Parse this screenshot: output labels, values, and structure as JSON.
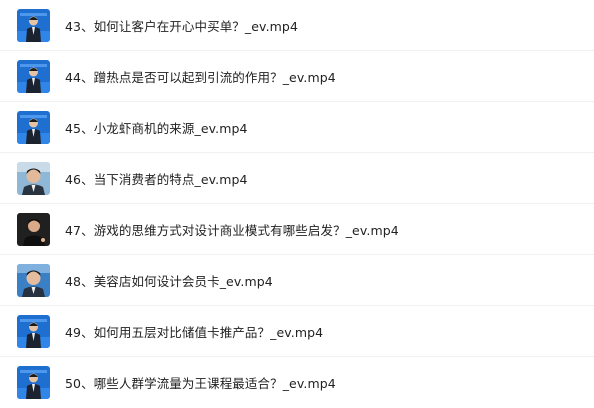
{
  "files": [
    {
      "name": "43、如何让客户在开心中买单？_ev.mp4",
      "thumbnail": "video-thumbnail-blue-stage"
    },
    {
      "name": "44、蹭热点是否可以起到引流的作用？_ev.mp4",
      "thumbnail": "video-thumbnail-blue-stage"
    },
    {
      "name": "45、小龙虾商机的来源_ev.mp4",
      "thumbnail": "video-thumbnail-blue-stage"
    },
    {
      "name": "46、当下消费者的特点_ev.mp4",
      "thumbnail": "video-thumbnail-closeup"
    },
    {
      "name": "47、游戏的思维方式对设计商业模式有哪些启发？_ev.mp4",
      "thumbnail": "video-thumbnail-dark"
    },
    {
      "name": "48、美容店如何设计会员卡_ev.mp4",
      "thumbnail": "video-thumbnail-closeup"
    },
    {
      "name": "49、如何用五层对比储值卡推产品？_ev.mp4",
      "thumbnail": "video-thumbnail-blue-stage"
    },
    {
      "name": "50、哪些人群学流量为王课程最适合？_ev.mp4",
      "thumbnail": "video-thumbnail-blue-stage"
    }
  ],
  "colors": {
    "text": "#222222",
    "divider": "#f1f1f3",
    "stage_blue": "#1f6fd1"
  }
}
